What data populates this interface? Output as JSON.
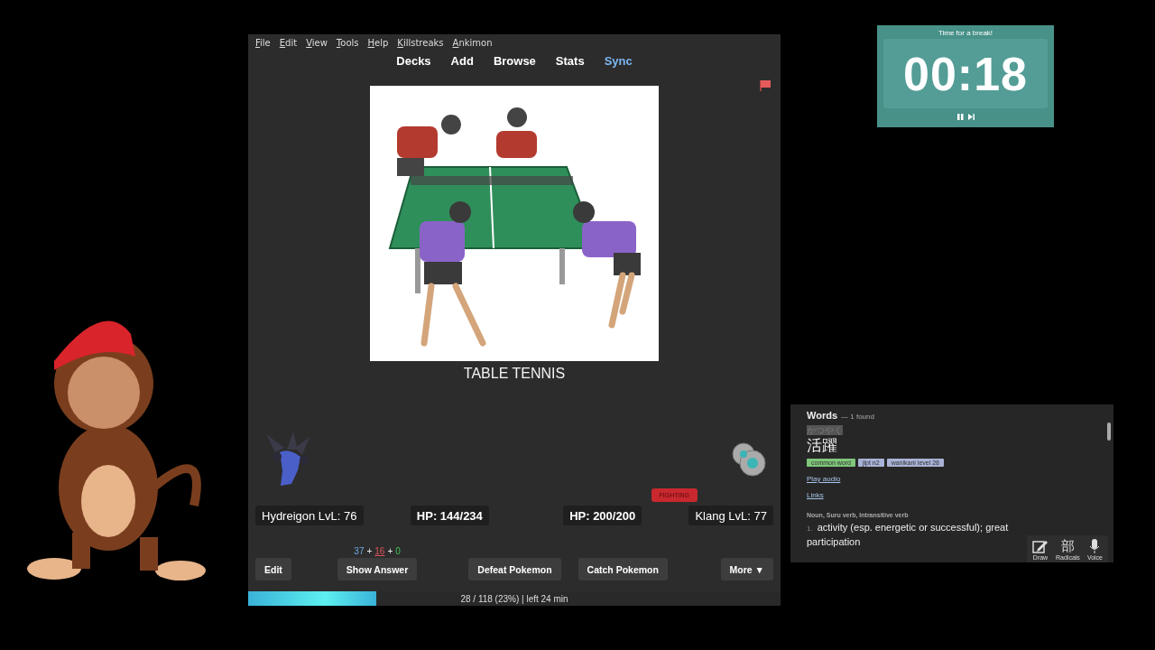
{
  "anki": {
    "menu": [
      "File",
      "Edit",
      "View",
      "Tools",
      "Help",
      "Killstreaks",
      "Ankimon"
    ],
    "toolbar": [
      {
        "label": "Decks",
        "highlighted": false
      },
      {
        "label": "Add",
        "highlighted": false
      },
      {
        "label": "Browse",
        "highlighted": false
      },
      {
        "label": "Stats",
        "highlighted": false
      },
      {
        "label": "Sync",
        "highlighted": true
      }
    ],
    "card": {
      "caption": "TABLE TENNIS"
    },
    "battle": {
      "player": {
        "name_level": "Hydreigon LvL: 76",
        "hp": "HP: 144/234"
      },
      "enemy": {
        "hp": "HP: 200/200",
        "name_level": "Klang LvL: 77",
        "type_badge": "FIGHTING"
      }
    },
    "counts": [
      {
        "value": "37",
        "kind": "new",
        "current": false
      },
      {
        "value": "16",
        "kind": "learn",
        "current": true
      },
      {
        "value": "0",
        "kind": "review",
        "current": false
      }
    ],
    "count_separator": "+",
    "buttons": [
      {
        "label": "Edit",
        "kind": "edit"
      },
      {
        "label": "Show Answer",
        "kind": "answer"
      },
      {
        "label": "Defeat Pokemon",
        "kind": "defeat"
      },
      {
        "label": "Catch Pokemon",
        "kind": "catch"
      },
      {
        "label": "More ▼",
        "kind": "more"
      }
    ],
    "progress": {
      "level": 0.24,
      "text": "28 / 118 (23%) | left 24 min"
    }
  },
  "timer": {
    "title": "Time for a break!",
    "time": "00:18"
  },
  "dictionary": {
    "heading": "Words",
    "found": "— 1 found",
    "reading": "かつやく",
    "word": "活躍",
    "tags": [
      {
        "label": "common word",
        "color": "#7fc57a"
      },
      {
        "label": "jlpt n2",
        "color": "#a9b2d6"
      },
      {
        "label": "wanikani level 28",
        "color": "#a9b2d6"
      }
    ],
    "links": [
      "Play audio",
      "Links"
    ],
    "part_of_speech": "Noun, Suru verb, Intransitive verb",
    "definition_number": "1.",
    "definition": "activity (esp. energetic or successful); great",
    "definition_continued": "participation",
    "tools": [
      {
        "label": "Draw",
        "kind": "draw"
      },
      {
        "label": "Radicals",
        "kind": "glyph",
        "glyph": "部"
      },
      {
        "label": "Voice",
        "kind": "voice"
      }
    ]
  }
}
